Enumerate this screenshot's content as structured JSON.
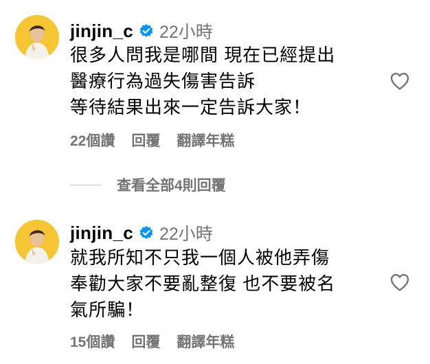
{
  "comments": [
    {
      "username": "jinjin_c",
      "timestamp": "22小時",
      "lines": [
        "很多人問我是哪間 現在已經提出",
        "醫療行為過失傷害告訴",
        "等待結果出來一定告訴大家！"
      ],
      "likes": "22個讚",
      "reply_label": "回覆",
      "translate_label": "翻譯年糕"
    },
    {
      "username": "jinjin_c",
      "timestamp": "22小時",
      "lines": [
        "就我所知不只我一個人被他弄傷",
        "奉勸大家不要亂整復 也不要被名",
        "氣所騙！"
      ],
      "likes": "15個讚",
      "reply_label": "回覆",
      "translate_label": "翻譯年糕"
    }
  ],
  "view_replies": "查看全部4則回覆",
  "colors": {
    "verified": "#0095f6",
    "secondary_text": "#737373",
    "avatar_bg": "#f6c533"
  },
  "icons": [
    "verified-badge-icon",
    "heart-outline-icon"
  ]
}
